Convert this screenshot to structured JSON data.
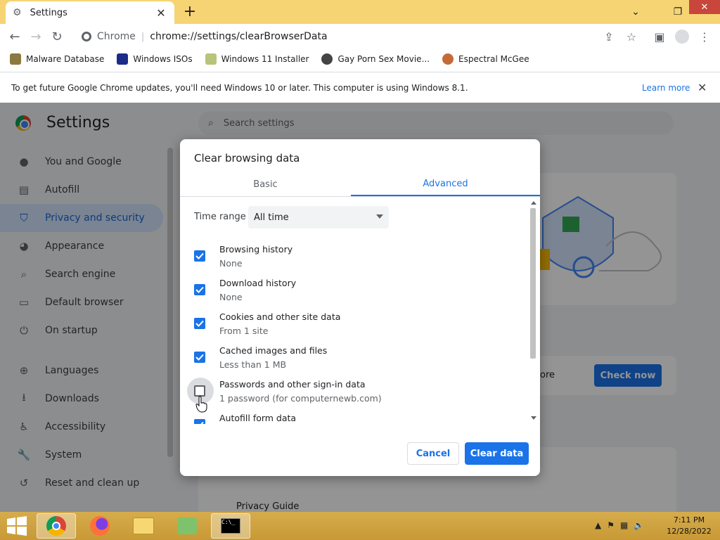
{
  "browser": {
    "tab_title": "Settings",
    "omnibox_site": "Chrome",
    "omnibox_url": "chrome://settings/clearBrowserData"
  },
  "bookmarks": [
    {
      "label": "Malware Database"
    },
    {
      "label": "Windows ISOs"
    },
    {
      "label": "Windows 11 Installer"
    },
    {
      "label": "Gay Porn Sex Movie..."
    },
    {
      "label": "Espectral McGee"
    }
  ],
  "infobar": {
    "message": "To get future Google Chrome updates, you'll need Windows 10 or later. This computer is using Windows 8.1.",
    "learn_more": "Learn more"
  },
  "settings": {
    "title": "Settings",
    "search_placeholder": "Search settings",
    "nav": [
      {
        "label": "You and Google",
        "icon": "person-icon"
      },
      {
        "label": "Autofill",
        "icon": "clipboard-icon"
      },
      {
        "label": "Privacy and security",
        "icon": "shield-icon"
      },
      {
        "label": "Appearance",
        "icon": "palette-icon"
      },
      {
        "label": "Search engine",
        "icon": "search-icon"
      },
      {
        "label": "Default browser",
        "icon": "browser-icon"
      },
      {
        "label": "On startup",
        "icon": "power-icon"
      },
      {
        "label": "Languages",
        "icon": "globe-icon"
      },
      {
        "label": "Downloads",
        "icon": "download-icon"
      },
      {
        "label": "Accessibility",
        "icon": "accessibility-icon"
      },
      {
        "label": "System",
        "icon": "wrench-icon"
      },
      {
        "label": "Reset and clean up",
        "icon": "history-icon"
      }
    ],
    "safety_partial_text": "ore",
    "check_now": "Check now",
    "privacy_guide": "Privacy Guide",
    "accent": "#1a73e8"
  },
  "dialog": {
    "title": "Clear browsing data",
    "tabs": {
      "basic": "Basic",
      "advanced": "Advanced"
    },
    "time_range_label": "Time range",
    "time_range_value": "All time",
    "options": [
      {
        "title": "Browsing history",
        "sub": "None",
        "checked": true
      },
      {
        "title": "Download history",
        "sub": "None",
        "checked": true
      },
      {
        "title": "Cookies and other site data",
        "sub": "From 1 site",
        "checked": true
      },
      {
        "title": "Cached images and files",
        "sub": "Less than 1 MB",
        "checked": true
      },
      {
        "title": "Passwords and other sign-in data",
        "sub": "1 password (for computernewb.com)",
        "checked": false
      },
      {
        "title": "Autofill form data",
        "sub": "",
        "checked": true
      }
    ],
    "cancel": "Cancel",
    "clear": "Clear data"
  },
  "taskbar": {
    "time": "7:11 PM",
    "date": "12/28/2022"
  }
}
